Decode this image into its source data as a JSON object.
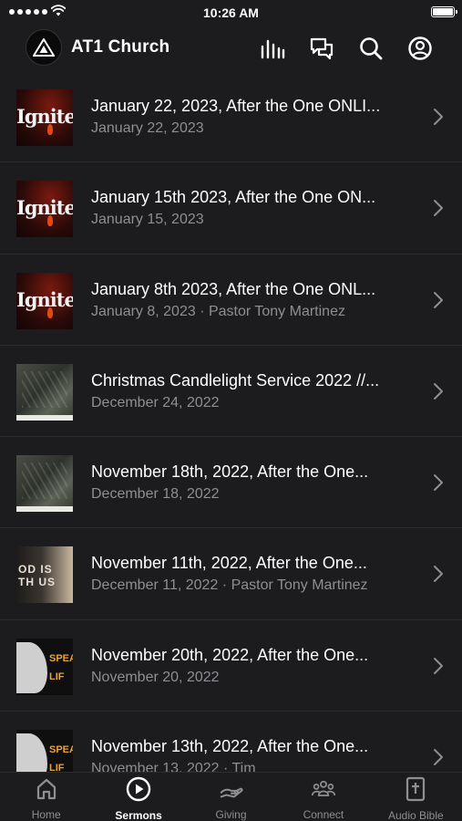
{
  "status_bar": {
    "time": "10:26 AM"
  },
  "header": {
    "title": "AT1 Church"
  },
  "sermons": [
    {
      "title": "January 22, 2023, After the One ONLI...",
      "subtitle": "January 22, 2023",
      "thumbnail": "ignite",
      "thumb_text": "Ignite"
    },
    {
      "title": "January 15th 2023, After the One ON...",
      "subtitle": "January 15, 2023",
      "thumbnail": "ignite",
      "thumb_text": "Ignite"
    },
    {
      "title": "January 8th 2023, After the One ONL...",
      "subtitle": "January 8, 2023 · Pastor Tony Martinez",
      "thumbnail": "ignite",
      "thumb_text": "Ignite"
    },
    {
      "title": "Christmas Candlelight Service 2022 //...",
      "subtitle": "December 24, 2022",
      "thumbnail": "christmas"
    },
    {
      "title": "November 18th, 2022, After the One...",
      "subtitle": "December 18, 2022",
      "thumbnail": "christmas"
    },
    {
      "title": "November 11th, 2022, After the One...",
      "subtitle": "December 11, 2022 · Pastor Tony Martinez",
      "thumbnail": "god-is-with-us",
      "thumb_text": "OD IS\nTH US"
    },
    {
      "title": "November 20th, 2022, After the One...",
      "subtitle": "November 20, 2022",
      "thumbnail": "speak-life",
      "thumb_text": "SPEA\nLIF"
    },
    {
      "title": "November 13th, 2022, After the One...",
      "subtitle": "November 13, 2022 · Tim",
      "thumbnail": "speak-life",
      "thumb_text": "SPEA\nLIF"
    }
  ],
  "tabs": [
    {
      "label": "Home",
      "icon": "home-icon",
      "active": false
    },
    {
      "label": "Sermons",
      "icon": "play-circle-icon",
      "active": true
    },
    {
      "label": "Giving",
      "icon": "giving-hand-icon",
      "active": false
    },
    {
      "label": "Connect",
      "icon": "people-icon",
      "active": false
    },
    {
      "label": "Audio Bible",
      "icon": "bible-icon",
      "active": false
    }
  ],
  "colors": {
    "background": "#1c1c1e",
    "secondary_text": "#8e8e93",
    "divider": "#2d2d30"
  }
}
